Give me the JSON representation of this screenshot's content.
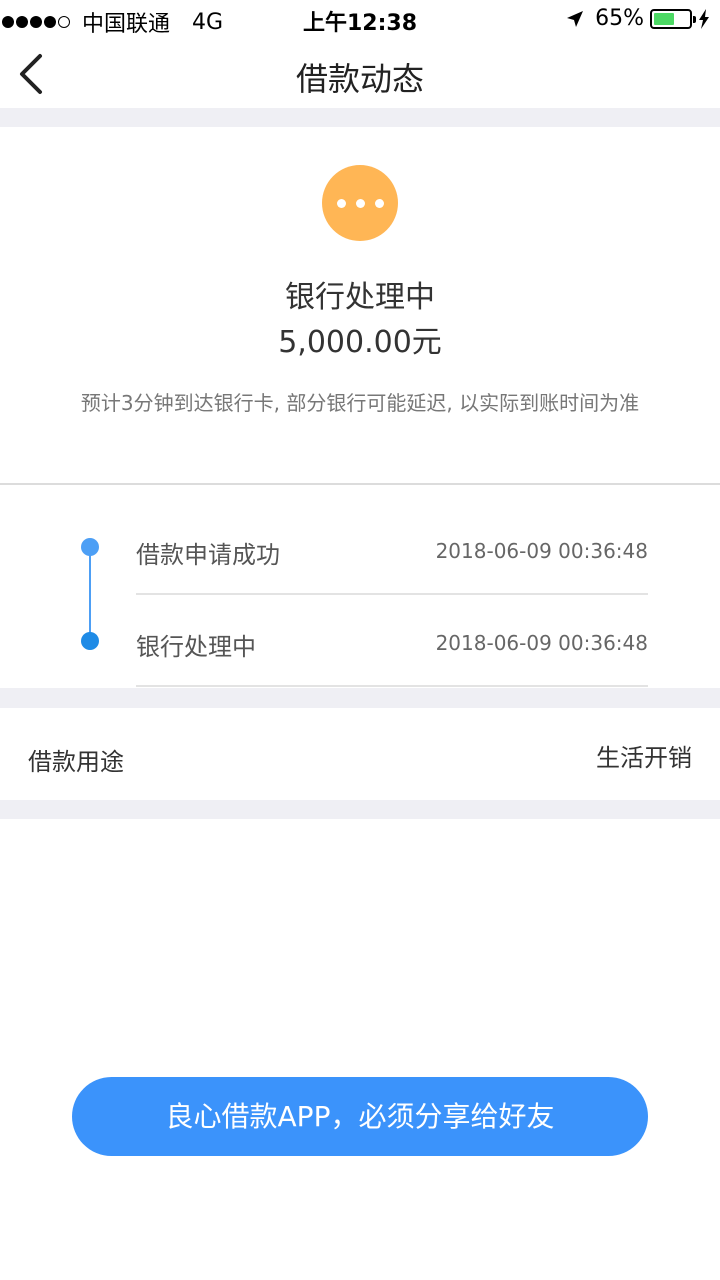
{
  "status_bar": {
    "carrier": "中国联通",
    "network": "4G",
    "time": "上午12:38",
    "battery": "65%",
    "battery_level": 0.65,
    "icons": [
      "signal-dots-icon",
      "location-arrow-icon",
      "battery-icon",
      "charging-bolt-icon"
    ]
  },
  "nav": {
    "title": "借款动态",
    "back_icon": "chevron-left-icon"
  },
  "status": {
    "icon": "more-dots-icon",
    "icon_color": "#ffb655",
    "title": "银行处理中",
    "amount": "5,000.00元",
    "note": "预计3分钟到达银行卡, 部分银行可能延迟, 以实际到账时间为准"
  },
  "timeline": [
    {
      "label": "借款申请成功",
      "time": "2018-06-09 00:36:48"
    },
    {
      "label": "银行处理中",
      "time": "2018-06-09 00:36:48"
    }
  ],
  "purpose": {
    "label": "借款用途",
    "value": "生活开销"
  },
  "share": {
    "label": "良心借款APP，必须分享给好友",
    "color": "#3b93fb"
  }
}
